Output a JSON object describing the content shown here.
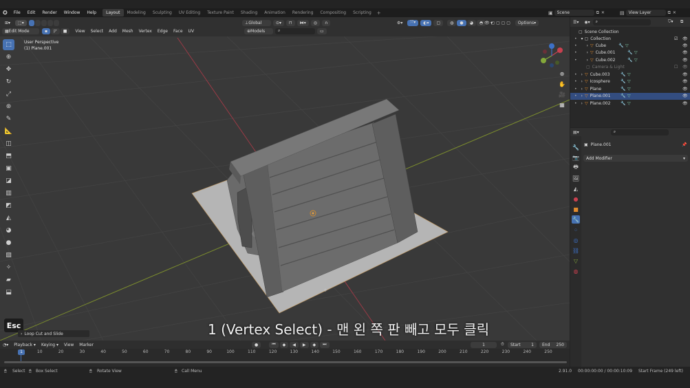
{
  "menu": {
    "file": "File",
    "edit": "Edit",
    "render": "Render",
    "window": "Window",
    "help": "Help"
  },
  "workspaces": [
    "Layout",
    "Modeling",
    "Sculpting",
    "UV Editing",
    "Texture Paint",
    "Shading",
    "Animation",
    "Rendering",
    "Compositing",
    "Scripting"
  ],
  "active_workspace": "Layout",
  "add_workspace": "+",
  "scene": {
    "label": "Scene"
  },
  "view_layer": {
    "label": "View Layer"
  },
  "header": {
    "mode": "Edit Mode",
    "menus": [
      "View",
      "Select",
      "Add",
      "Mesh",
      "Vertex",
      "Edge",
      "Face",
      "UV"
    ],
    "transform_orientation": "Global",
    "snap_target": "Models",
    "options": "Options"
  },
  "viewport": {
    "perspective_label": "User Perspective",
    "object_label": "(1) Plane.001",
    "gizmo": {
      "x": "X",
      "y": "Y",
      "z": "Z"
    }
  },
  "subtitle": "1 (Vertex Select) - 맨 왼 쪽 판 빼고 모두 클릭",
  "key_overlay": {
    "key": "Esc",
    "operation": "Loop Cut and Slide"
  },
  "timeline": {
    "menus": [
      "Playback",
      "Keying",
      "View",
      "Marker"
    ],
    "current_frame": "1",
    "start_label": "Start",
    "start": "1",
    "end_label": "End",
    "end": "250",
    "ticks": [
      "1",
      "10",
      "20",
      "30",
      "40",
      "50",
      "60",
      "70",
      "80",
      "90",
      "100",
      "110",
      "120",
      "130",
      "140",
      "150",
      "160",
      "170",
      "180",
      "190",
      "200",
      "210",
      "220",
      "230",
      "240",
      "250"
    ]
  },
  "status": {
    "select": "Select",
    "box_select": "Box Select",
    "rotate_view": "Rotate View",
    "call_menu": "Call Menu",
    "version": "2.91.0",
    "time": "00:00:00:00 / 00:00:10:09",
    "start_frame": "Start Frame (249 left)"
  },
  "outliner": {
    "root": "Scene Collection",
    "collection": "Collection",
    "items": [
      "Cube",
      "Cube.001",
      "Cube.002"
    ],
    "camera_light": "Camera & Light",
    "objects": [
      "Cube.003",
      "Icosphere",
      "Plane",
      "Plane.001",
      "Plane.002"
    ],
    "selected": "Plane.001"
  },
  "properties": {
    "object_name": "Plane.001",
    "add_modifier": "Add Modifier"
  },
  "colors": {
    "accent": "#4772b3",
    "selected_row": "#334d80",
    "x_axis": "#c8404f",
    "y_axis": "#84a83a",
    "z_axis": "#3d71c8"
  }
}
